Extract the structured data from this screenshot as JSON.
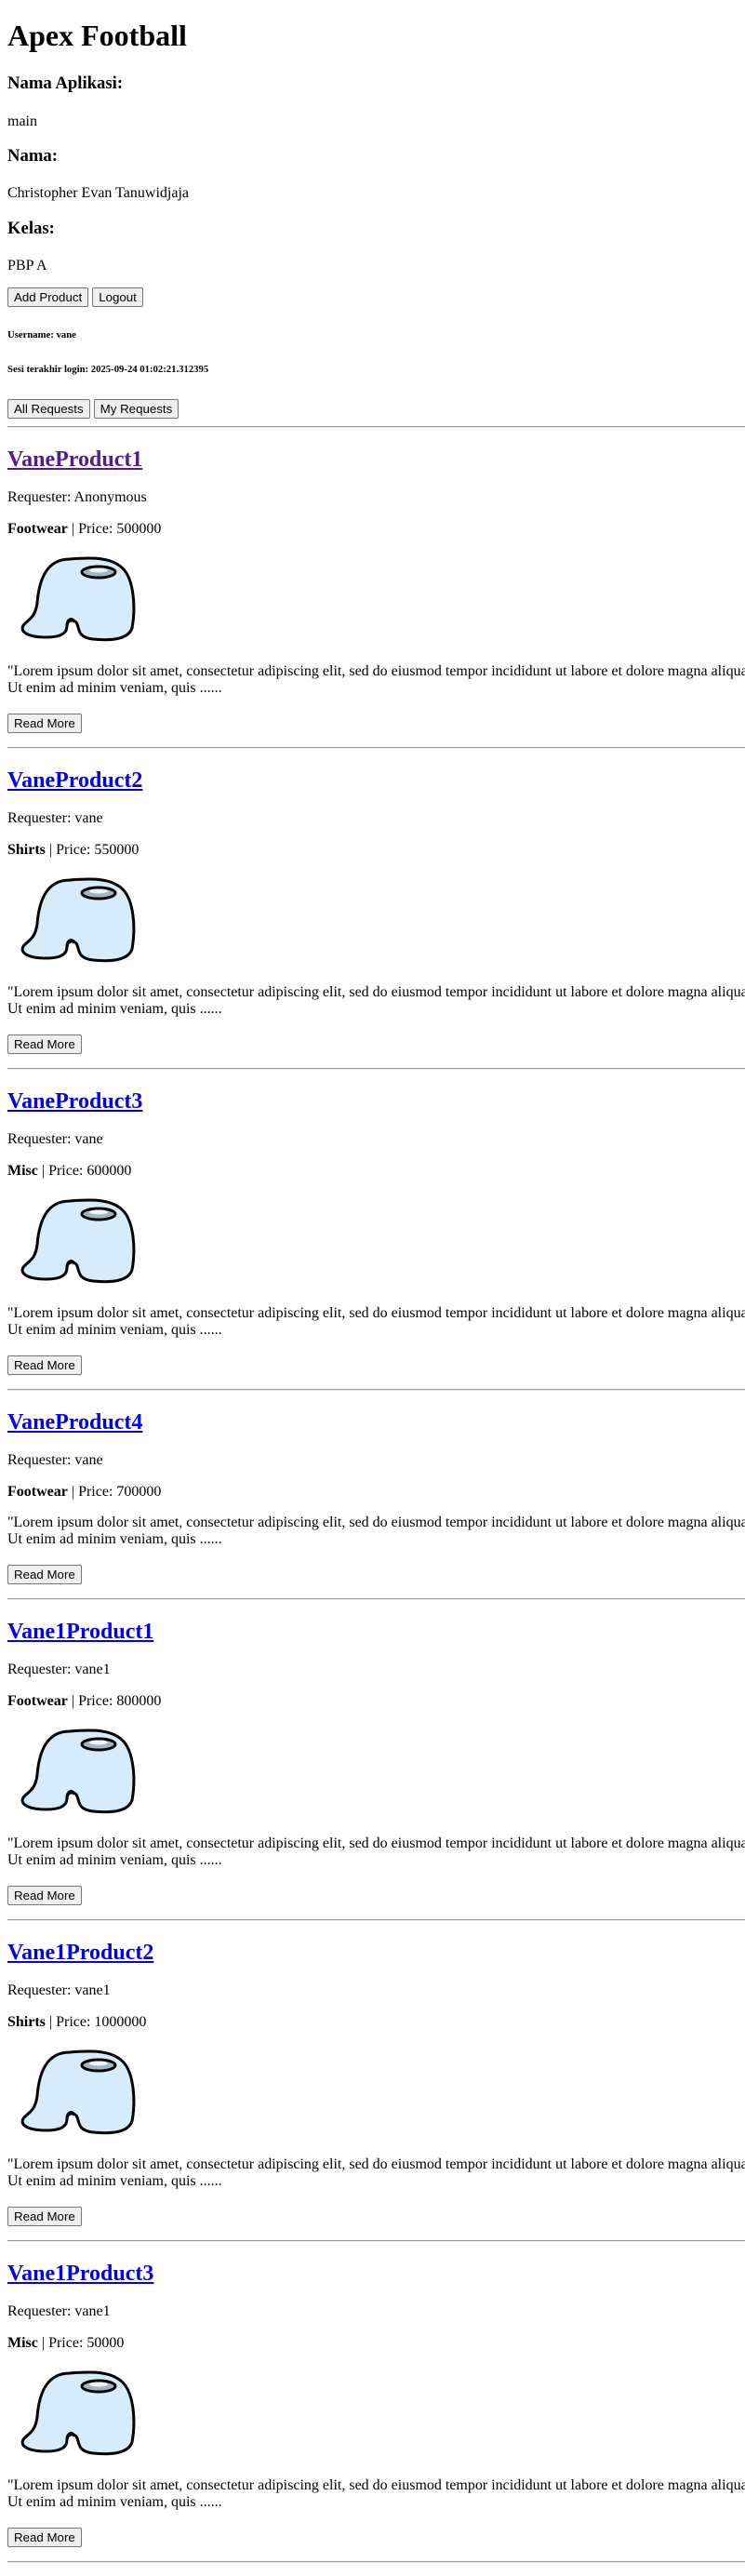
{
  "app": {
    "title": "Apex Football"
  },
  "info": {
    "app_name_label": "Nama Aplikasi:",
    "app_name_value": "main",
    "name_label": "Nama:",
    "name_value": "Christopher Evan Tanuwidjaja",
    "class_label": "Kelas:",
    "class_value": "PBP A"
  },
  "actions": {
    "add_product": "Add Product",
    "logout": "Logout"
  },
  "session": {
    "username_text": "Username: vane",
    "last_login_text": "Sesi terakhir login: 2025-09-24 01:02:21.312395"
  },
  "filters": {
    "all_requests": "All Requests",
    "my_requests": "My Requests"
  },
  "labels": {
    "price_prefix": " | Price: ",
    "read_more": "Read More",
    "desc_line1": "\"Lorem ipsum dolor sit amet, consectetur adipiscing elit, sed do eiusmod tempor incididunt ut labore et dolore magna aliqua.",
    "desc_line2": "Ut enim ad minim veniam, quis ......"
  },
  "products": [
    {
      "name": "VaneProduct1",
      "visited": true,
      "requester": "Requester: Anonymous",
      "category": "Footwear",
      "price": "500000",
      "has_image": true
    },
    {
      "name": "VaneProduct2",
      "visited": false,
      "requester": "Requester: vane",
      "category": "Shirts",
      "price": "550000",
      "has_image": true
    },
    {
      "name": "VaneProduct3",
      "visited": false,
      "requester": "Requester: vane",
      "category": "Misc",
      "price": "600000",
      "has_image": true
    },
    {
      "name": "VaneProduct4",
      "visited": false,
      "requester": "Requester: vane",
      "category": "Footwear",
      "price": "700000",
      "has_image": false
    },
    {
      "name": "Vane1Product1",
      "visited": false,
      "requester": "Requester: vane1",
      "category": "Footwear",
      "price": "800000",
      "has_image": true
    },
    {
      "name": "Vane1Product2",
      "visited": false,
      "requester": "Requester: vane1",
      "category": "Shirts",
      "price": "1000000",
      "has_image": true
    },
    {
      "name": "Vane1Product3",
      "visited": false,
      "requester": "Requester: vane1",
      "category": "Misc",
      "price": "50000",
      "has_image": true
    }
  ],
  "colors": {
    "link_visited": "#551a8b",
    "link_unvisited": "#0000ee",
    "thumb_fill": "#d6ecfa",
    "thumb_visor": "#9fb6c4"
  },
  "icons": {
    "thumbnail": "blob-character-icon"
  }
}
